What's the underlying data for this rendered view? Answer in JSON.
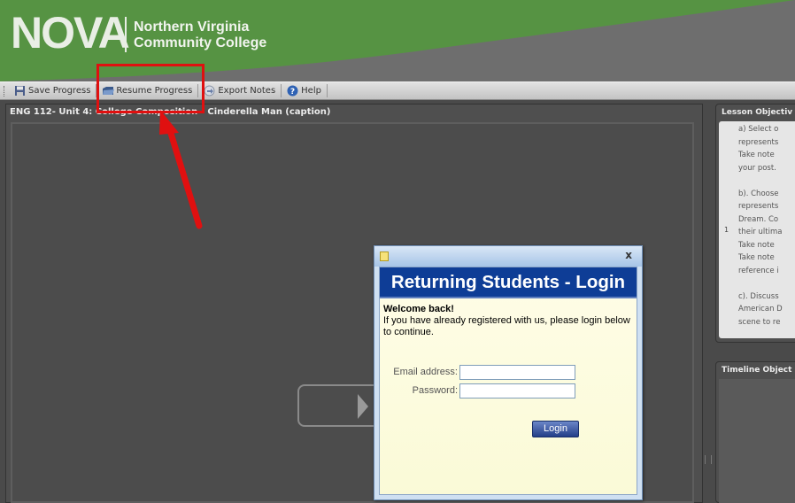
{
  "header": {
    "logo_main": "NOVA",
    "logo_line1": "Northern Virginia",
    "logo_line2": "Community College"
  },
  "toolbar": {
    "save_label": "Save Progress",
    "resume_label": "Resume Progress",
    "export_label": "Export Notes",
    "help_label": "Help"
  },
  "main": {
    "title": "ENG 112- Unit 4: College Composition - Cinderella Man (caption)"
  },
  "lesson": {
    "title": "Lesson Objectiv",
    "row_number": "1",
    "lines": [
      "a) Select o",
      "represents",
      "Take note",
      "your post.",
      "",
      "b). Choose",
      "represents",
      "Dream. Co",
      "their ultima",
      "Take note",
      "Take note",
      "reference i",
      "",
      "c). Discuss",
      "American D",
      "scene to re"
    ]
  },
  "timeline": {
    "title": "Timeline Object"
  },
  "dialog": {
    "close_symbol": "x",
    "header": "Returning Students - Login",
    "welcome": "Welcome back!",
    "intro": "If you have already registered with us, please login below to continue.",
    "email_label": "Email address:",
    "password_label": "Password:",
    "email_value": "",
    "password_value": "",
    "login_label": "Login"
  },
  "colors": {
    "header_green": "#4f8a3d",
    "dialog_header_blue": "#0e3d96",
    "annotation_red": "#e01010"
  }
}
